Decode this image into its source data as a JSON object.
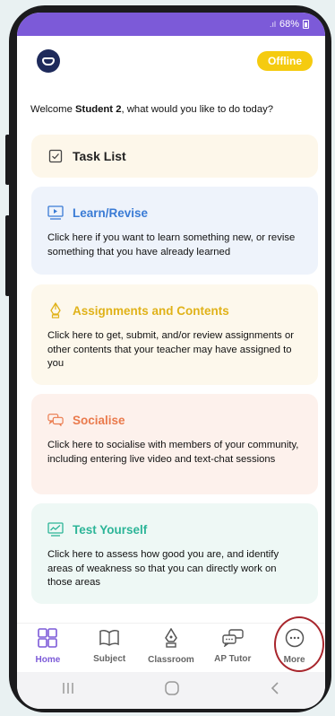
{
  "status_bar": {
    "signal": ".ıl",
    "battery": "68%"
  },
  "header": {
    "offline_label": "Offline"
  },
  "welcome": {
    "prefix": "Welcome ",
    "name": "Student 2",
    "suffix": ", what would you like to do today?"
  },
  "cards": {
    "task_list": {
      "title": "Task List"
    },
    "learn": {
      "title": "Learn/Revise",
      "description": "Click here if you want to learn something new, or revise something that you have already learned"
    },
    "assignments": {
      "title": "Assignments and Contents",
      "description": "Click here to get, submit, and/or review assignments or other contents that your teacher may have assigned to you"
    },
    "socialise": {
      "title": "Socialise",
      "description": "Click here to socialise with members of your community, including entering live video and text-chat sessions"
    },
    "test": {
      "title": "Test Yourself",
      "description": "Click here to assess how good you are, and identify areas of weakness so that you can directly work on those areas"
    }
  },
  "nav": {
    "home": "Home",
    "subject": "Subject",
    "classroom": "Classroom",
    "ap_tutor": "AP Tutor",
    "more": "More"
  },
  "colors": {
    "accent": "#7c5ad8",
    "offline": "#f5cb10",
    "learn": "#3a7bd5",
    "assignments": "#e0b219",
    "socialise": "#ea7a4c",
    "test": "#2db598",
    "highlight": "#a8262d"
  },
  "icons": [
    "task-list-icon",
    "learn-icon",
    "assignments-icon",
    "socialise-icon",
    "test-icon",
    "home-icon",
    "subject-icon",
    "classroom-icon",
    "ap-tutor-icon",
    "more-icon"
  ]
}
